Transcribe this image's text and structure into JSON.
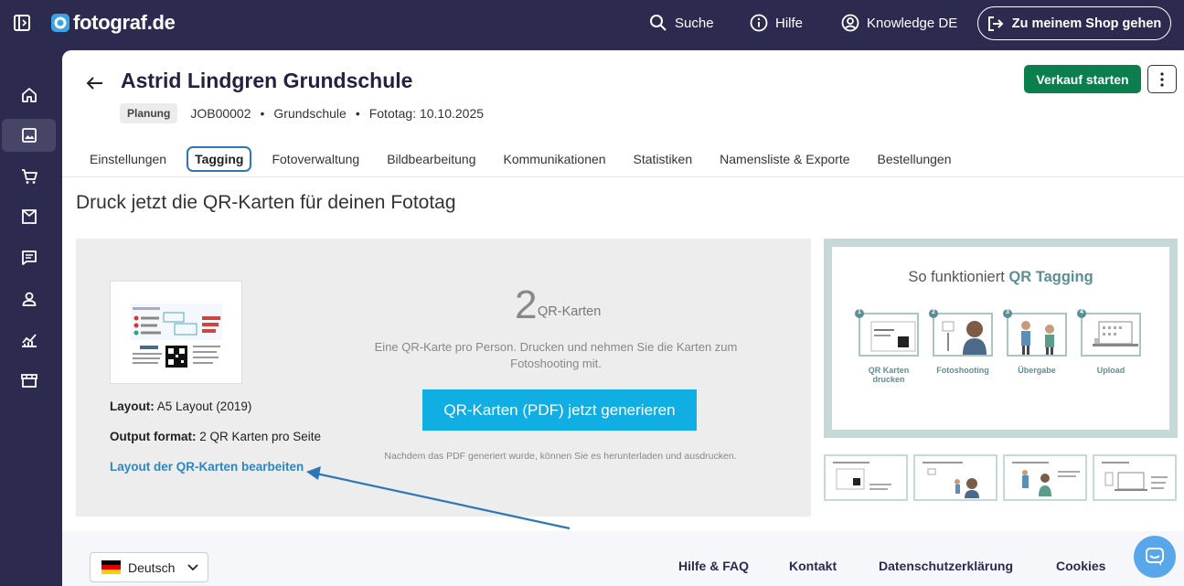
{
  "topbar": {
    "logo": "fotograf.de",
    "search": "Suche",
    "help": "Hilfe",
    "knowledge": "Knowledge DE",
    "shop": "Zu meinem Shop gehen"
  },
  "header": {
    "title": "Astrid Lindgren Grundschule",
    "status": "Planung",
    "job_id": "JOB00002",
    "school_type": "Grundschule",
    "photo_day": "Fototag: 10.10.2025",
    "start_sale": "Verkauf starten"
  },
  "tabs": [
    {
      "label": "Einstellungen"
    },
    {
      "label": "Tagging"
    },
    {
      "label": "Fotoverwaltung"
    },
    {
      "label": "Bildbearbeitung"
    },
    {
      "label": "Kommunikationen"
    },
    {
      "label": "Statistiken"
    },
    {
      "label": "Namensliste & Exporte"
    },
    {
      "label": "Bestellungen"
    }
  ],
  "active_tab": "Tagging",
  "main": {
    "section_title": "Druck jetzt die QR-Karten für deinen Fototag",
    "layout_label": "Layout:",
    "layout_value": "A5 Layout (2019)",
    "output_label": "Output format:",
    "output_value": "2 QR Karten pro Seite",
    "edit_link": "Layout der QR-Karten bearbeiten",
    "count": "2",
    "count_label": "QR-Karten",
    "description": "Eine QR-Karte pro Person. Drucken und nehmen Sie die Karten zum Fotoshooting mit.",
    "generate_button": "QR-Karten (PDF) jetzt generieren",
    "note": "Nachdem das PDF generiert wurde, können Sie es herunterladen und ausdrucken."
  },
  "preview": {
    "title_prefix": "So funktioniert",
    "title_highlight": "QR Tagging",
    "steps": [
      "QR Karten drucken",
      "Fotoshooting",
      "Übergabe",
      "Upload"
    ],
    "step_numbers": [
      "1",
      "2",
      "3",
      "4"
    ]
  },
  "footer": {
    "language": "Deutsch",
    "links": [
      "Hilfe & FAQ",
      "Kontakt",
      "Datenschutzerklärung",
      "Cookies"
    ]
  },
  "colors": {
    "navy": "#2c2a4f",
    "green": "#0b7e4e",
    "cyan": "#11aee4",
    "link_blue": "#2e86c1",
    "teal": "#5b8f96"
  }
}
